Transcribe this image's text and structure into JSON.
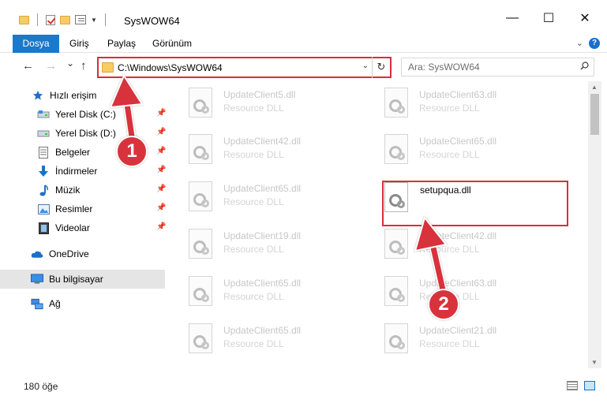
{
  "window": {
    "title": "SysWOW64",
    "minimize_glyph": "—",
    "maximize_glyph": "☐",
    "close_glyph": "✕"
  },
  "ribbon": {
    "tabs": [
      {
        "label": "Dosya"
      },
      {
        "label": "Giriş"
      },
      {
        "label": "Paylaş"
      },
      {
        "label": "Görünüm"
      }
    ],
    "help_glyph": "?"
  },
  "nav": {
    "back_glyph": "←",
    "forward_glyph": "→",
    "recent_glyph": "⌄",
    "up_glyph": "↑"
  },
  "address": {
    "path": "C:\\Windows\\SysWOW64",
    "refresh_glyph": "↻"
  },
  "search": {
    "placeholder": "Ara: SysWOW64"
  },
  "sidebar": {
    "items": [
      {
        "label": "Hızlı erişim",
        "icon": "star-icon"
      },
      {
        "label": "Yerel Disk (C:)",
        "icon": "drive-icon"
      },
      {
        "label": "Yerel Disk (D:)",
        "icon": "drive-icon"
      },
      {
        "label": "Belgeler",
        "icon": "documents-icon"
      },
      {
        "label": "İndirmeler",
        "icon": "download-icon"
      },
      {
        "label": "Müzik",
        "icon": "music-icon"
      },
      {
        "label": "Resimler",
        "icon": "pictures-icon"
      },
      {
        "label": "Videolar",
        "icon": "videos-icon"
      },
      {
        "label": "OneDrive",
        "icon": "cloud-icon"
      },
      {
        "label": "Bu bilgisayar",
        "icon": "computer-icon"
      },
      {
        "label": "Ağ",
        "icon": "network-icon"
      }
    ]
  },
  "files": [
    {
      "name": "UpdateClient5.dll",
      "type": "Resource DLL"
    },
    {
      "name": "UpdateClient63.dll",
      "type": "Resource DLL"
    },
    {
      "name": "UpdateClient42.dll",
      "type": "Resource DLL"
    },
    {
      "name": "UpdateClient65.dll",
      "type": "Resource DLL"
    },
    {
      "name": "UpdateClient65.dll",
      "type": "Resource DLL"
    },
    {
      "name": "setupqua.dll",
      "type": ""
    },
    {
      "name": "UpdateClient19.dll",
      "type": "Resource DLL"
    },
    {
      "name": "UpdateClient42.dll",
      "type": "Resource DLL"
    },
    {
      "name": "UpdateClient65.dll",
      "type": "Resource DLL"
    },
    {
      "name": "UpdateClient63.dll",
      "type": "Resource DLL"
    },
    {
      "name": "UpdateClient65.dll",
      "type": "Resource DLL"
    },
    {
      "name": "UpdateClient21.dll",
      "type": "Resource DLL"
    }
  ],
  "status": {
    "item_count": "180 öğe"
  },
  "markers": [
    {
      "label": "1"
    },
    {
      "label": "2"
    }
  ],
  "colors": {
    "accent": "#1979ca",
    "highlight_red": "#d6303a",
    "selected_bg": "#e5e5e5"
  }
}
